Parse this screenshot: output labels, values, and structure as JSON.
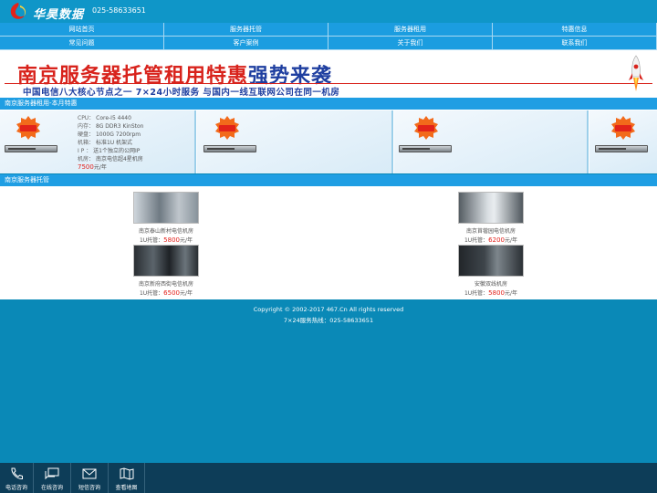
{
  "header": {
    "logo_text": "华昊数据",
    "phone": "025-58633651"
  },
  "nav": {
    "items": [
      "网站首页",
      "服务器托管",
      "服务器租用",
      "特惠信息",
      "常见问题",
      "客户案例",
      "关于我们",
      "联系我们"
    ]
  },
  "banner": {
    "headline_red": "南京服务器托管租用特惠",
    "headline_blue": "强势来袭",
    "subline": "中国电信八大核心节点之一   7×24小时服务   与国内一线互联网公司在同一机房",
    "badge_text": "特价促销"
  },
  "promo_section": {
    "title": "南京服务器租用-本月特惠",
    "card": {
      "specs": [
        {
          "k": "CPU：",
          "v": "Core-I5 4440"
        },
        {
          "k": "内存：",
          "v": "8G DDR3 KinSton"
        },
        {
          "k": "硬盘：",
          "v": "1000G 7200rpm"
        },
        {
          "k": "机箱：",
          "v": "标准1U 机架式"
        },
        {
          "k": "I P ：",
          "v": "送1个独立的公网IP"
        },
        {
          "k": "机房：",
          "v": "南京电信超4星机房"
        }
      ],
      "price_value": "7500",
      "price_unit": "元/年"
    }
  },
  "hosting_section": {
    "title": "南京服务器托管",
    "label_prefix": "1U托管：",
    "unit": "元/年",
    "items": [
      {
        "name": "南京泰山新村电信机房",
        "price": "5800"
      },
      {
        "name": "南京苜蓿园电信机房",
        "price": "6200"
      },
      {
        "name": "南京新府西街电信机房",
        "price": "6500"
      },
      {
        "name": "安徽双线机房",
        "price": "5800"
      }
    ]
  },
  "footer": {
    "copyright": "Copyright © 2002-2017  467.Cn All rights reserved",
    "hotline": "7×24服务热线：025-58633651"
  },
  "bottom_bar": {
    "items": [
      {
        "label": "电话咨询",
        "icon": "phone-icon"
      },
      {
        "label": "在线咨询",
        "icon": "chat-icon"
      },
      {
        "label": "短信咨询",
        "icon": "envelope-icon"
      },
      {
        "label": "查看地图",
        "icon": "map-icon"
      }
    ]
  },
  "colors": {
    "accent": "#1b9de0",
    "header": "#0f96c8",
    "page_bg": "#0a89b7",
    "price": "#e3211b",
    "bottom_bar": "#0d3d58"
  }
}
